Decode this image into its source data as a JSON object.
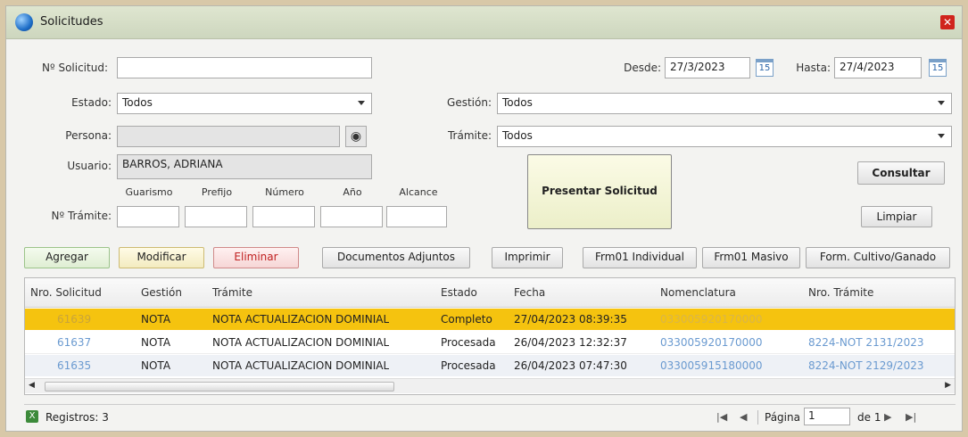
{
  "window": {
    "title": "Solicitudes"
  },
  "form": {
    "nro_solicitud_label": "Nº Solicitud:",
    "nro_solicitud_value": "",
    "desde_label": "Desde:",
    "desde_value": "27/3/2023",
    "hasta_label": "Hasta:",
    "hasta_value": "27/4/2023",
    "calendar_glyph": "15",
    "estado_label": "Estado:",
    "estado_value": "Todos",
    "gestion_label": "Gestión:",
    "gestion_value": "Todos",
    "persona_label": "Persona:",
    "persona_value": "",
    "tramite_label": "Trámite:",
    "tramite_value": "Todos",
    "usuario_label": "Usuario:",
    "usuario_value": "BARROS, ADRIANA",
    "nro_tramite_label": "Nº Trámite:",
    "tramite_parts": [
      "Guarismo",
      "Prefijo",
      "Número",
      "Año",
      "Alcance"
    ]
  },
  "buttons": {
    "presentar": "Presentar Solicitud",
    "consultar": "Consultar",
    "limpiar": "Limpiar",
    "agregar": "Agregar",
    "modificar": "Modificar",
    "eliminar": "Eliminar",
    "documentos": "Documentos Adjuntos",
    "imprimir": "Imprimir",
    "frm01_individual": "Frm01 Individual",
    "frm01_masivo": "Frm01 Masivo",
    "form_cultivo": "Form. Cultivo/Ganado"
  },
  "table": {
    "columns": [
      "Nro. Solicitud",
      "Gestión",
      "Trámite",
      "Estado",
      "Fecha",
      "Nomenclatura",
      "Nro. Trámite"
    ],
    "rows": [
      [
        "61639",
        "NOTA",
        "NOTA ACTUALIZACION DOMINIAL",
        "Completo",
        "27/04/2023 08:39:35",
        "033005920170000",
        ""
      ],
      [
        "61637",
        "NOTA",
        "NOTA ACTUALIZACION DOMINIAL",
        "Procesada",
        "26/04/2023 12:32:37",
        "033005920170000",
        "8224-NOT 2131/2023"
      ],
      [
        "61635",
        "NOTA",
        "NOTA ACTUALIZACION DOMINIAL",
        "Procesada",
        "26/04/2023 07:47:30",
        "033005915180000",
        "8224-NOT 2129/2023"
      ]
    ],
    "selected_row": 0
  },
  "status": {
    "registros": "Registros: 3",
    "pagina_label": "Página",
    "pagina_value": "1",
    "de_label": "de 1"
  },
  "colors": {
    "selected_row": "#f5c30f",
    "link": "#6a9ad0",
    "title_bar": "#d8dfc8"
  }
}
